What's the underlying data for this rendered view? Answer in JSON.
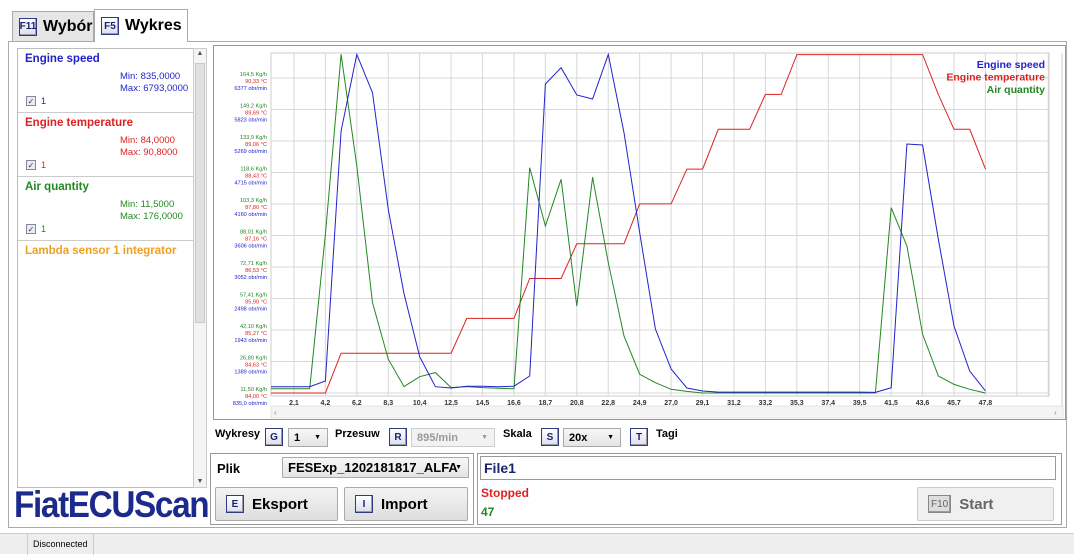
{
  "tabs": [
    {
      "key": "F11",
      "label": "Wybór"
    },
    {
      "key": "F5",
      "label": "Wykres"
    }
  ],
  "sidebar": {
    "items": [
      {
        "name": "Engine speed",
        "min": "Min: 835,0000",
        "max": "Max: 6793,0000",
        "checkbox_label": "1",
        "color": "#2222cc"
      },
      {
        "name": "Engine temperature",
        "min": "Min: 84,0000",
        "max": "Max: 90,8000",
        "checkbox_label": "1",
        "color": "#dd2222"
      },
      {
        "name": "Air quantity",
        "min": "Min: 11,5000",
        "max": "Max: 176,0000",
        "checkbox_label": "1",
        "color": "#228822"
      },
      {
        "name": "Lambda sensor 1 integrator",
        "color": "#f0a020"
      }
    ]
  },
  "logo": "FiatECUScan",
  "controls": {
    "wykresy_label": "Wykresy",
    "wykresy_key": "G",
    "wykresy_value": "1",
    "przesuw_label": "Przesuw",
    "przesuw_key": "R",
    "przesuw_value": "895/min",
    "skala_label": "Skala",
    "skala_key": "S",
    "skala_value": "20x",
    "tagi_key": "T",
    "tagi_label": "Tagi"
  },
  "file": {
    "label": "Plik",
    "selected": "FESExp_1202181817_ALFA",
    "export_key": "E",
    "export_label": "Eksport",
    "import_key": "I",
    "import_label": "Import"
  },
  "session": {
    "name": "File1",
    "state": "Stopped",
    "count": "47",
    "start_key": "F10",
    "start_label": "Start"
  },
  "statusbar": {
    "connection": "Disconnected"
  },
  "chart_data": {
    "type": "line",
    "xlim": [
      0.56,
      52.0
    ],
    "x_tick_labels": [
      "2,1",
      "4,2",
      "6,2",
      "8,3",
      "10,4",
      "12,5",
      "14,5",
      "16,6",
      "18,7",
      "20,8",
      "22,8",
      "24,9",
      "27,0",
      "29,1",
      "31,2",
      "33,2",
      "35,3",
      "37,4",
      "39,5",
      "41,5",
      "43,6",
      "45,7",
      "47,8"
    ],
    "x_tick_step": 2.078,
    "grid": true,
    "legend_position": "top-right",
    "x_step": 1.0391,
    "series": [
      {
        "name": "Engine speed",
        "color": "#2222cc",
        "axis_min": 835,
        "axis_step": 554.2,
        "tick_labels": [
          "835,0 obr/min",
          "1389 obr/min",
          "1943 obr/min",
          "2498 obr/min",
          "3052 obr/min",
          "3606 obr/min",
          "4160 obr/min",
          "4715 obr/min",
          "5269 obr/min",
          "5823 obr/min",
          "6377 obr/min"
        ],
        "values": [
          946,
          946,
          946,
          946,
          1046,
          5445,
          6793,
          6118,
          4061,
          2583,
          1474,
          946,
          923,
          955,
          955,
          946,
          955,
          1134,
          6272,
          6558,
          6078,
          6007,
          6793,
          5415,
          3655,
          1961,
          1257,
          923,
          870,
          851,
          851,
          851,
          851,
          851,
          851,
          851,
          851,
          851,
          851,
          845,
          928,
          5216,
          5198,
          3545,
          2014,
          1222,
          870
        ]
      },
      {
        "name": "Engine temperature",
        "color": "#dd2222",
        "axis_min": 84,
        "axis_step": 0.633,
        "tick_labels": [
          "84,00 °C",
          "84,63 °C",
          "85,27 °C",
          "85,90 °C",
          "86,53 °C",
          "87,16 °C",
          "87,80 °C",
          "88,43 °C",
          "89,06 °C",
          "89,69 °C",
          "90,33 °C"
        ],
        "values": [
          84,
          84,
          84,
          84,
          84,
          84.8,
          84.8,
          84.8,
          84.8,
          84.8,
          84.8,
          84.8,
          84.8,
          85.5,
          85.5,
          85.5,
          85.5,
          86.3,
          86.3,
          86.3,
          87.0,
          87.0,
          87.0,
          87.0,
          87.8,
          87.8,
          87.8,
          88.5,
          88.5,
          89.3,
          89.3,
          89.3,
          90.0,
          90.0,
          90.8,
          90.8,
          90.8,
          90.8,
          90.8,
          90.8,
          90.8,
          90.8,
          90.8,
          90.0,
          89.3,
          89.3,
          88.5
        ]
      },
      {
        "name": "Air quantity",
        "color": "#228822",
        "axis_min": 11.5,
        "axis_step": 15.3,
        "tick_labels": [
          "11,50 Kg/h",
          "26,80 Kg/h",
          "42,10 Kg/h",
          "57,41 Kg/h",
          "72,71 Kg/h",
          "88,01 Kg/h",
          "103,3 Kg/h",
          "118,6 Kg/h",
          "133,9 Kg/h",
          "149,2 Kg/h",
          "164,5 Kg/h"
        ],
        "values": [
          13.6,
          13.6,
          13.6,
          13.6,
          88.6,
          176,
          121.8,
          55.4,
          27.9,
          14.6,
          19.4,
          21.4,
          14.1,
          14.6,
          14.1,
          13.8,
          13.6,
          121,
          92.6,
          115.3,
          53.8,
          116.3,
          74.8,
          39.2,
          20.6,
          16.5,
          13.3,
          12.3,
          11.5,
          11.5,
          11.5,
          11.5,
          11.5,
          11.5,
          11.5,
          11.5,
          11.5,
          11.5,
          11.5,
          11.5,
          101.5,
          82.9,
          40,
          19.8,
          15.7,
          13.3,
          11.5
        ]
      }
    ]
  }
}
